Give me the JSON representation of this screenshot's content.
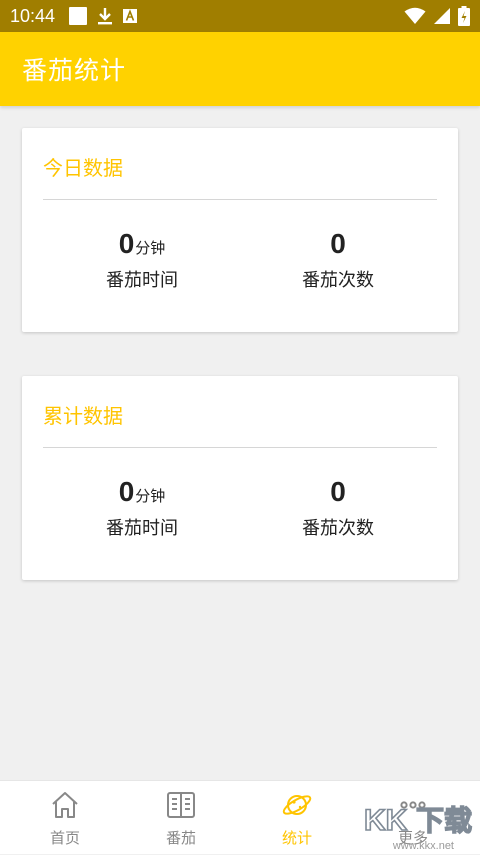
{
  "status_bar": {
    "time": "10:44",
    "icons_left": [
      "notification-square-icon",
      "download-icon",
      "a-icon"
    ],
    "icons_right": [
      "wifi-icon",
      "signal-icon",
      "battery-icon"
    ]
  },
  "app_bar": {
    "title": "番茄统计",
    "color": "#ffd200"
  },
  "cards": {
    "today": {
      "title": "今日数据",
      "time_value": "0",
      "time_unit": "分钟",
      "time_label": "番茄时间",
      "count_value": "0",
      "count_label": "番茄次数"
    },
    "total": {
      "title": "累计数据",
      "time_value": "0",
      "time_unit": "分钟",
      "time_label": "番茄时间",
      "count_value": "0",
      "count_label": "番茄次数"
    }
  },
  "bottom_nav": {
    "items": [
      {
        "label": "首页",
        "icon": "home-icon",
        "active": false
      },
      {
        "label": "番茄",
        "icon": "book-icon",
        "active": false
      },
      {
        "label": "统计",
        "icon": "planet-icon",
        "active": true
      },
      {
        "label": "更多",
        "icon": "more-icon",
        "active": false
      }
    ]
  },
  "watermark": {
    "text": "KK下载",
    "url": "www.kkx.net"
  },
  "colors": {
    "accent": "#ffc400",
    "app_bar": "#ffd200",
    "status_bar": "#a07e00",
    "background": "#f0f0f0"
  }
}
